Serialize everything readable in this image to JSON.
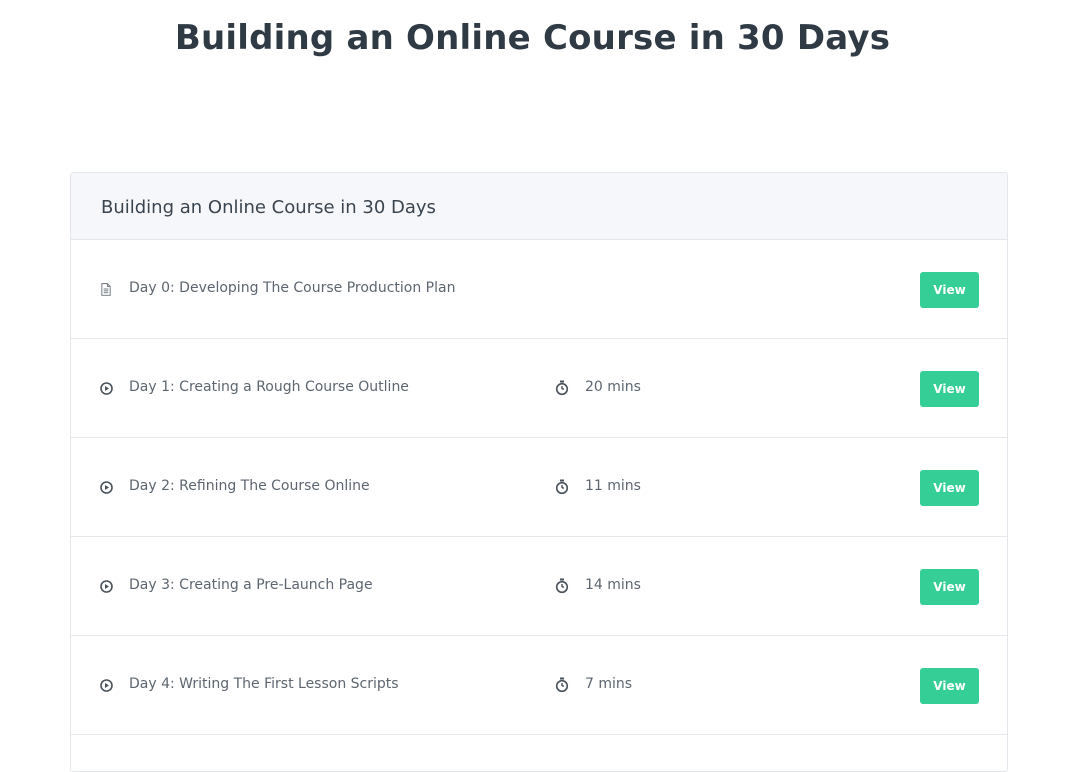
{
  "page": {
    "title": "Building an Online Course in 30 Days"
  },
  "course": {
    "section_title": "Building an Online Course in 30 Days",
    "lessons": [
      {
        "title": "Day 0: Developing The Course Production Plan",
        "type_icon": "document-icon",
        "duration": "",
        "button_label": "View"
      },
      {
        "title": "Day 1: Creating a Rough Course Outline",
        "type_icon": "play-circle-icon",
        "duration": "20 mins",
        "button_label": "View"
      },
      {
        "title": "Day 2: Refining The Course Online",
        "type_icon": "play-circle-icon",
        "duration": "11 mins",
        "button_label": "View"
      },
      {
        "title": "Day 3: Creating a Pre-Launch Page",
        "type_icon": "play-circle-icon",
        "duration": "14 mins",
        "button_label": "View"
      },
      {
        "title": "Day 4: Writing The First Lesson Scripts",
        "type_icon": "play-circle-icon",
        "duration": "7 mins",
        "button_label": "View"
      }
    ]
  },
  "colors": {
    "title_text": "#2f3a45",
    "header_bg": "#f6f7fa",
    "button_bg": "#35ce97",
    "body_text": "#5d6670"
  }
}
